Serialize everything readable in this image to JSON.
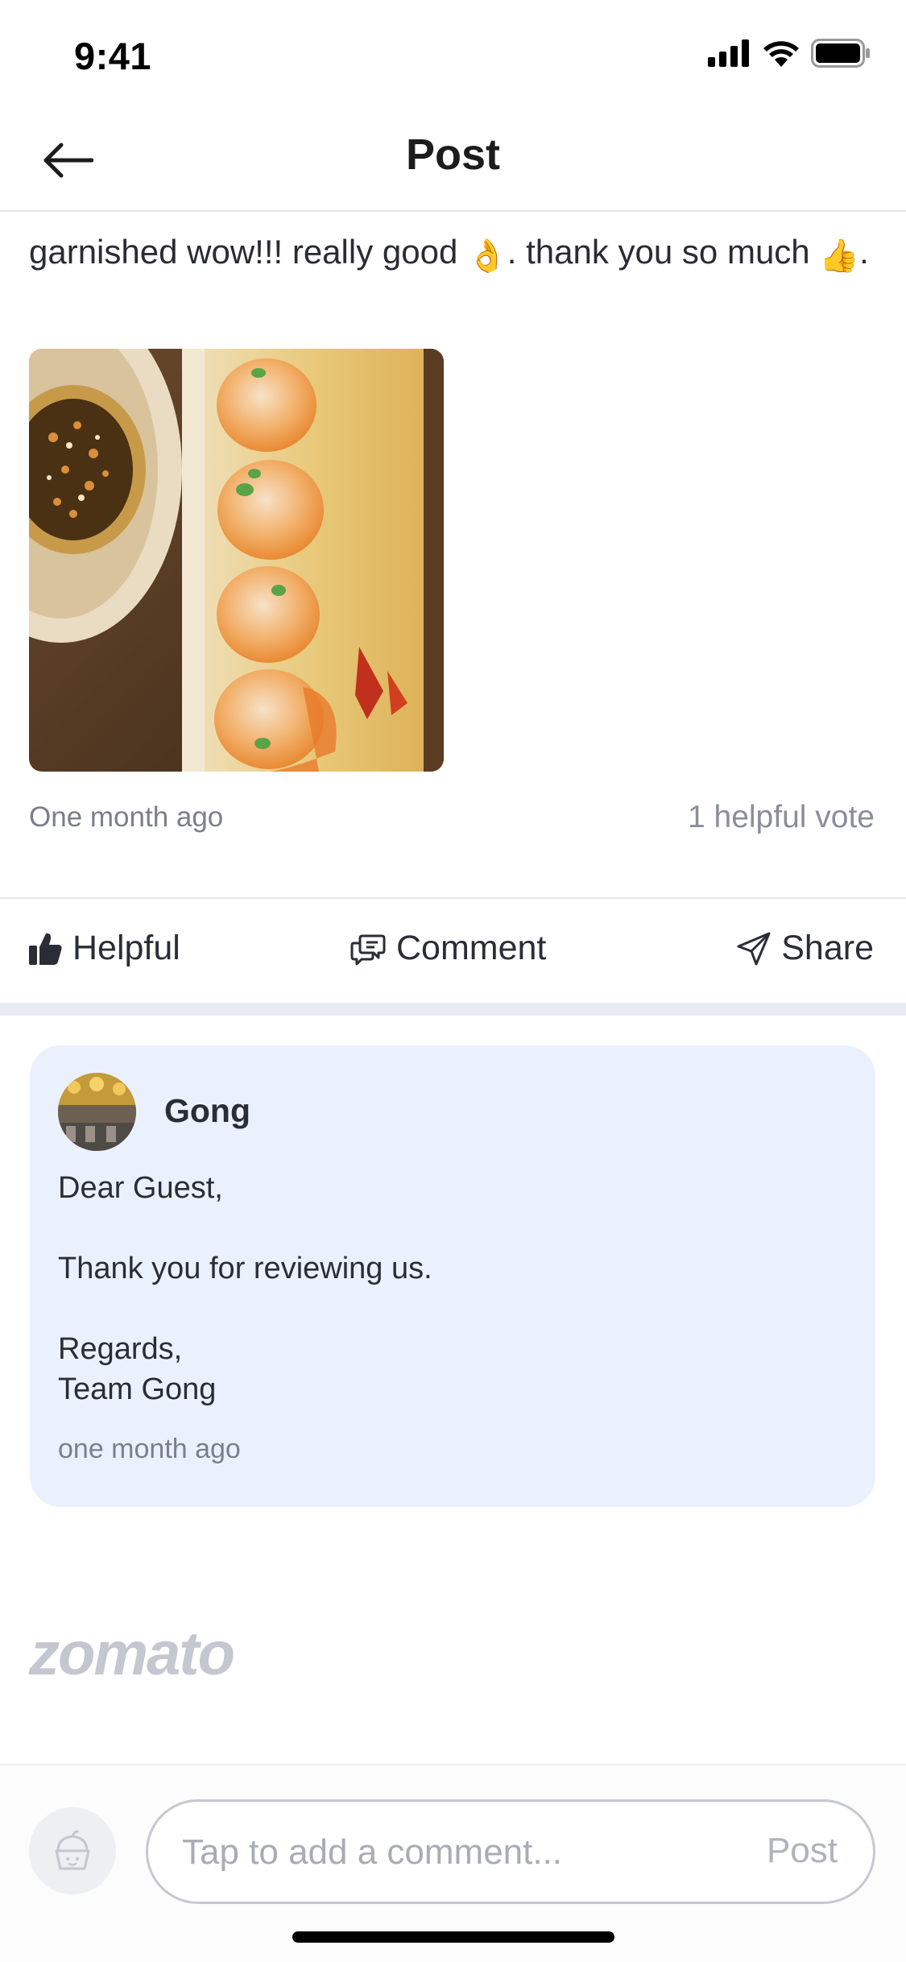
{
  "status_bar": {
    "time": "9:41"
  },
  "header": {
    "title": "Post"
  },
  "review": {
    "text_part1": "garnished wow!!! really good ",
    "emoji_ok": "👌",
    "text_part2": ". thank you so much ",
    "emoji_thumbs": "👍",
    "text_part3": ".",
    "date": "One month ago",
    "votes": "1 helpful vote"
  },
  "actions": {
    "helpful": "Helpful",
    "comment": "Comment",
    "share": "Share"
  },
  "reply": {
    "author": "Gong",
    "greeting": "Dear Guest,",
    "message": "Thank you for reviewing us.",
    "signoff": "Regards,",
    "team": "Team Gong",
    "date": "one month ago"
  },
  "brand": {
    "logo": "zomato"
  },
  "comment_bar": {
    "placeholder": "Tap to add a comment...",
    "post_label": "Post"
  },
  "colors": {
    "reply_bg": "#ebf1fc",
    "muted_text": "#7b7f8a",
    "logo": "#c4c6d0"
  }
}
